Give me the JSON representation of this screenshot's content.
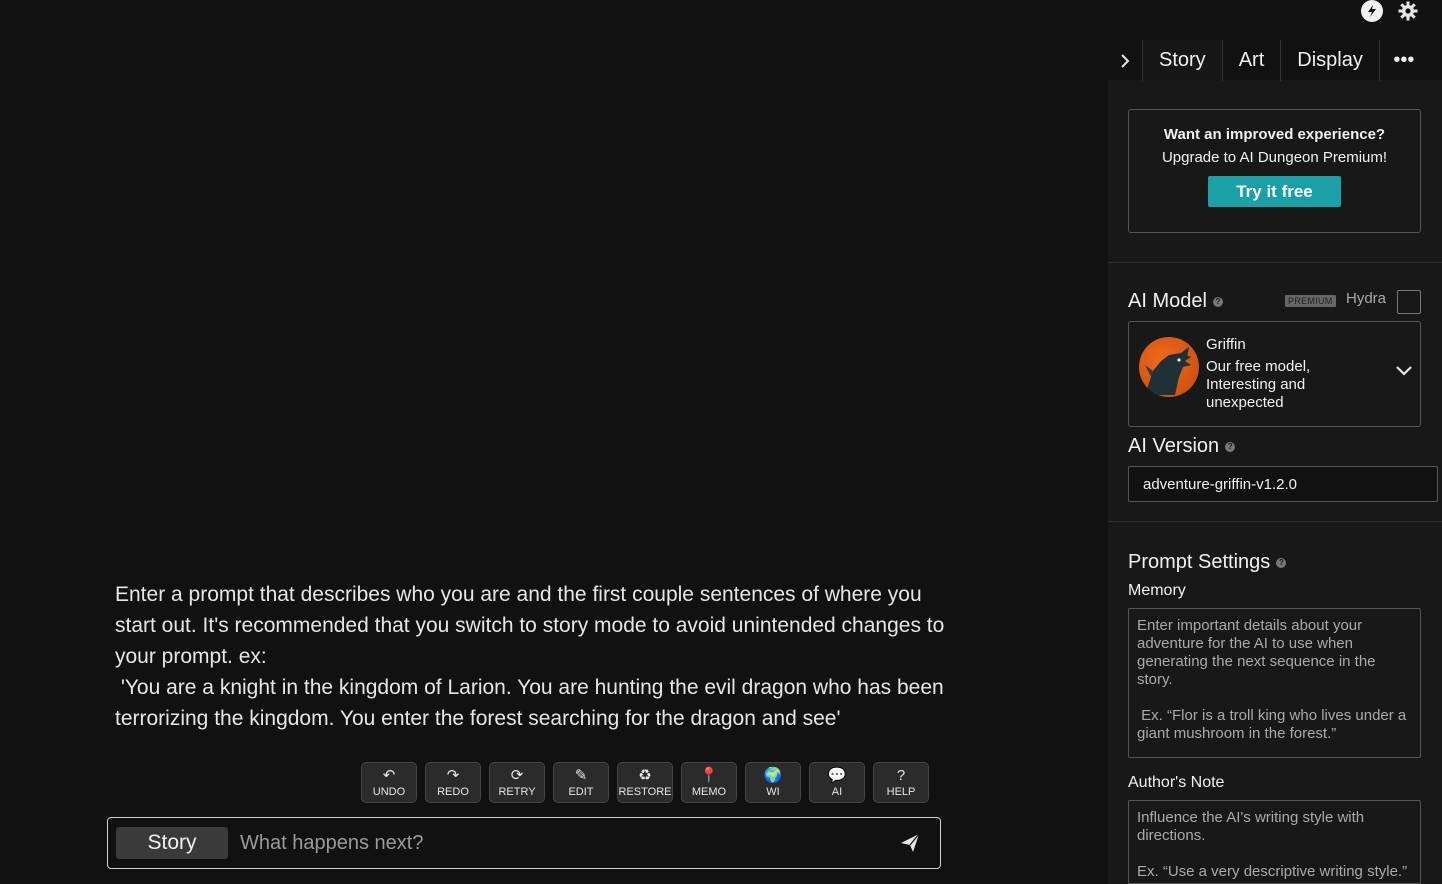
{
  "top_icons": {
    "bolt": "bolt-icon",
    "settings": "gear-icon"
  },
  "story": {
    "prompt_text": "Enter a prompt that describes who you are and the first couple sentences of where you start out. It's recommended that you switch to story mode to avoid unintended changes to your prompt. ex:\n 'You are a knight in the kingdom of Larion. You are hunting the evil dragon who has been terrorizing the kingdom. You enter the forest searching for the dragon and see'"
  },
  "actions": [
    {
      "label": "UNDO",
      "icon": "↶"
    },
    {
      "label": "REDO",
      "icon": "↷"
    },
    {
      "label": "RETRY",
      "icon": "⟳"
    },
    {
      "label": "EDIT",
      "icon": "✎"
    },
    {
      "label": "RESTORE",
      "icon": "♻"
    },
    {
      "label": "MEMO",
      "icon": "📍"
    },
    {
      "label": "WI",
      "icon": "🌍"
    },
    {
      "label": "AI",
      "icon": "💬"
    },
    {
      "label": "HELP",
      "icon": "?"
    }
  ],
  "input": {
    "mode_label": "Story",
    "placeholder": "What happens next?"
  },
  "tabs": {
    "arrow": ">",
    "story": "Story",
    "art": "Art",
    "display": "Display",
    "more": "•••"
  },
  "upsell": {
    "title": "Want an improved experience?",
    "subtitle": "Upgrade to AI Dungeon Premium!",
    "button": "Try it free"
  },
  "ai_model": {
    "title": "AI Model",
    "premium_badge": "PREMIUM",
    "hydra_label": "Hydra",
    "selected_name": "Griffin",
    "selected_desc": "Our free model, Interesting and unexpected"
  },
  "ai_version": {
    "title": "AI Version",
    "value": "adventure-griffin-v1.2.0"
  },
  "prompt_settings": {
    "title": "Prompt Settings",
    "memory_label": "Memory",
    "memory_placeholder": "Enter important details about your adventure for the AI to use when generating the next sequence in the story.\n\n Ex. “Flor is a troll king who lives under a giant mushroom in the forest.”",
    "authors_note_label": "Author's Note",
    "authors_note_placeholder": "Influence the AI's writing style with directions.\n\nEx. “Use a very descriptive writing style.”"
  }
}
